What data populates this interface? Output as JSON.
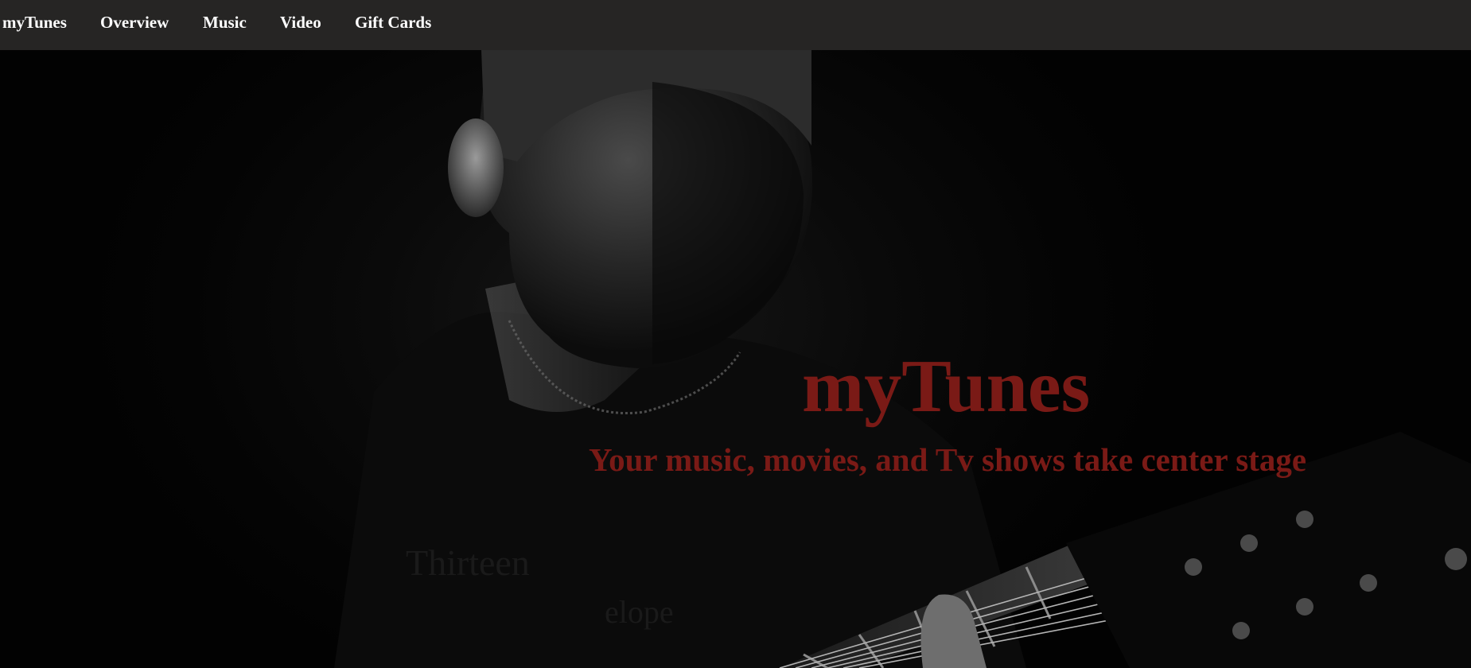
{
  "nav": {
    "brand": "myTunes",
    "items": [
      {
        "label": "Overview"
      },
      {
        "label": "Music"
      },
      {
        "label": "Video"
      },
      {
        "label": "Gift Cards"
      }
    ]
  },
  "hero": {
    "title": "myTunes",
    "subtitle": "Your music, movies, and Tv shows take center stage",
    "image_description_icon": "guitarist-photo"
  },
  "colors": {
    "nav_background": "#262524",
    "nav_text": "#ffffff",
    "accent": "#7a1a16",
    "hero_background": "#000000"
  }
}
